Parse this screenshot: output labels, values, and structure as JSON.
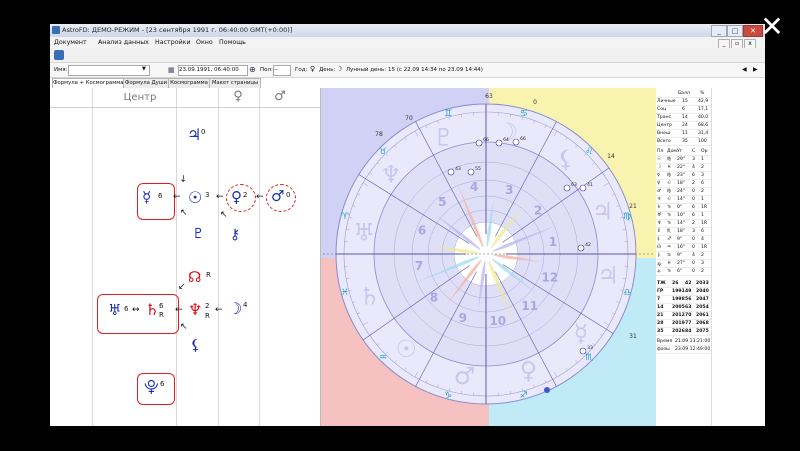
{
  "window": {
    "title": "AstroFD: ДЕМО-РЕЖИМ - [23 сентября 1991 г. 06:40:00 GMT(+0:00)]",
    "controls": {
      "minimize": "_",
      "maximize": "□",
      "close": "✕"
    }
  },
  "menu": {
    "items": [
      "Документ",
      "Анализ данных",
      "Настройки",
      "Окно",
      "Помощь"
    ],
    "mdi_controls": {
      "minimize": "_",
      "restore": "▫",
      "close": "x"
    }
  },
  "toolbar": {
    "name_label": "Имя:",
    "name_value": "",
    "date_value": "23.09.1991, 06:40:00",
    "pol_label": "Пол:",
    "pol_value": "--",
    "year_label": "Год:",
    "day_label": "День:",
    "lunar_day_label": "Лунный день:",
    "lunar_day_value": "15 (с 22.09 14:34 по 23.09 14:44)"
  },
  "tabs": [
    "Формула + Космограмма",
    "Формула Души",
    "Космограмма",
    "Макет страницы"
  ],
  "formula": {
    "headers": {
      "center": "Центр",
      "venus": "♀",
      "mars": "♂"
    },
    "glyphs": {
      "jupiter": "♃",
      "mercury": "☿",
      "sun": "☉",
      "venus": "♀",
      "mars": "♂",
      "pluto": "♇",
      "chiron": "⚷",
      "node": "☊",
      "uranus": "♅",
      "saturn": "♄",
      "neptune": "♆",
      "moon": "☽",
      "lilith": "⚸",
      "persephone": "⯓"
    },
    "nums": {
      "jupiter": "0",
      "mercury": "6",
      "sun": "3",
      "venus": "2",
      "mars": "0",
      "uranus": "6",
      "saturn": "6",
      "neptune": "2",
      "moon": "4",
      "persephone": "6"
    },
    "retro": "R"
  },
  "wheel": {
    "outer_degrees": [
      "63",
      "70",
      "78",
      "0",
      "14",
      "21",
      "31"
    ],
    "house_numbers": [
      "6",
      "5",
      "4",
      "3",
      "2",
      "1",
      "12",
      "11",
      "10",
      "9",
      "8",
      "7"
    ],
    "zodiac": [
      "♈",
      "♉",
      "♊",
      "♋",
      "♌",
      "♍",
      "♎",
      "♏",
      "♐",
      "♑",
      "♒",
      "♓"
    ],
    "small_labels": [
      "66",
      "64",
      "66",
      "63",
      "41",
      "42",
      "33",
      "43",
      "55"
    ],
    "colors": {
      "fire": "#f0a0a0",
      "earth": "#f4ee86",
      "air": "#9edff0",
      "water": "#b8b8f0"
    }
  },
  "stats": {
    "head": [
      "",
      "Балл",
      "%"
    ],
    "rows": [
      [
        "Личные",
        "15",
        "42,9"
      ],
      [
        "Соц",
        "6",
        "17,1"
      ],
      [
        "Транс",
        "14",
        "40,0"
      ],
      [
        "Центр",
        "24",
        "68,6"
      ],
      [
        "Внеш",
        "11",
        "31,4"
      ],
      [
        "Всего",
        "35",
        "100"
      ]
    ],
    "planet_head": [
      "Пл",
      "Дом",
      "Уг",
      "С",
      "Ор"
    ],
    "planets": [
      [
        "☉",
        "♍",
        "29°",
        "3",
        "1"
      ],
      [
        "☽",
        "♓",
        "22°",
        "4",
        "2"
      ],
      [
        "☿",
        "♍",
        "23°",
        "6",
        "3"
      ],
      [
        "♀",
        "♌",
        "18°",
        "2",
        "6"
      ],
      [
        "♂",
        "♍",
        "24°",
        "0",
        "2"
      ],
      [
        "♃",
        "♌",
        "14°",
        "0",
        "1"
      ],
      [
        "♄",
        "♑",
        "0°",
        "6",
        "1R"
      ],
      [
        "♅",
        "♑",
        "10°",
        "6",
        "1"
      ],
      [
        "♆",
        "♑",
        "14°",
        "2",
        "1R"
      ],
      [
        "♇",
        "♏",
        "18°",
        "3",
        "6"
      ],
      [
        "⚸",
        "♐",
        "9°",
        "0",
        "4"
      ],
      [
        "☊",
        "♒",
        "16°",
        "0",
        "1R"
      ],
      [
        "⚷",
        "♋",
        "9°",
        "4",
        "2"
      ],
      [
        "⯓",
        "♓",
        "27°",
        "0",
        "3"
      ],
      [
        "⚶",
        "♑",
        "6°",
        "0",
        "2"
      ]
    ],
    "cycles": [
      [
        "ТЖ",
        "26",
        "42",
        "2033"
      ],
      [
        "ГР",
        "1991",
        "49",
        "2040"
      ],
      [
        "7",
        "1998",
        "56",
        "2047"
      ],
      [
        "14",
        "2005",
        "63",
        "2054"
      ],
      [
        "21",
        "2012",
        "70",
        "2061"
      ],
      [
        "28",
        "2019",
        "77",
        "2068"
      ],
      [
        "35",
        "2026",
        "84",
        "2075"
      ]
    ],
    "footer": [
      [
        "Время",
        "21.09 13:21:00"
      ],
      [
        "фазы",
        "23.09 12:49:00"
      ]
    ]
  },
  "overlay": {
    "close": "✕"
  }
}
